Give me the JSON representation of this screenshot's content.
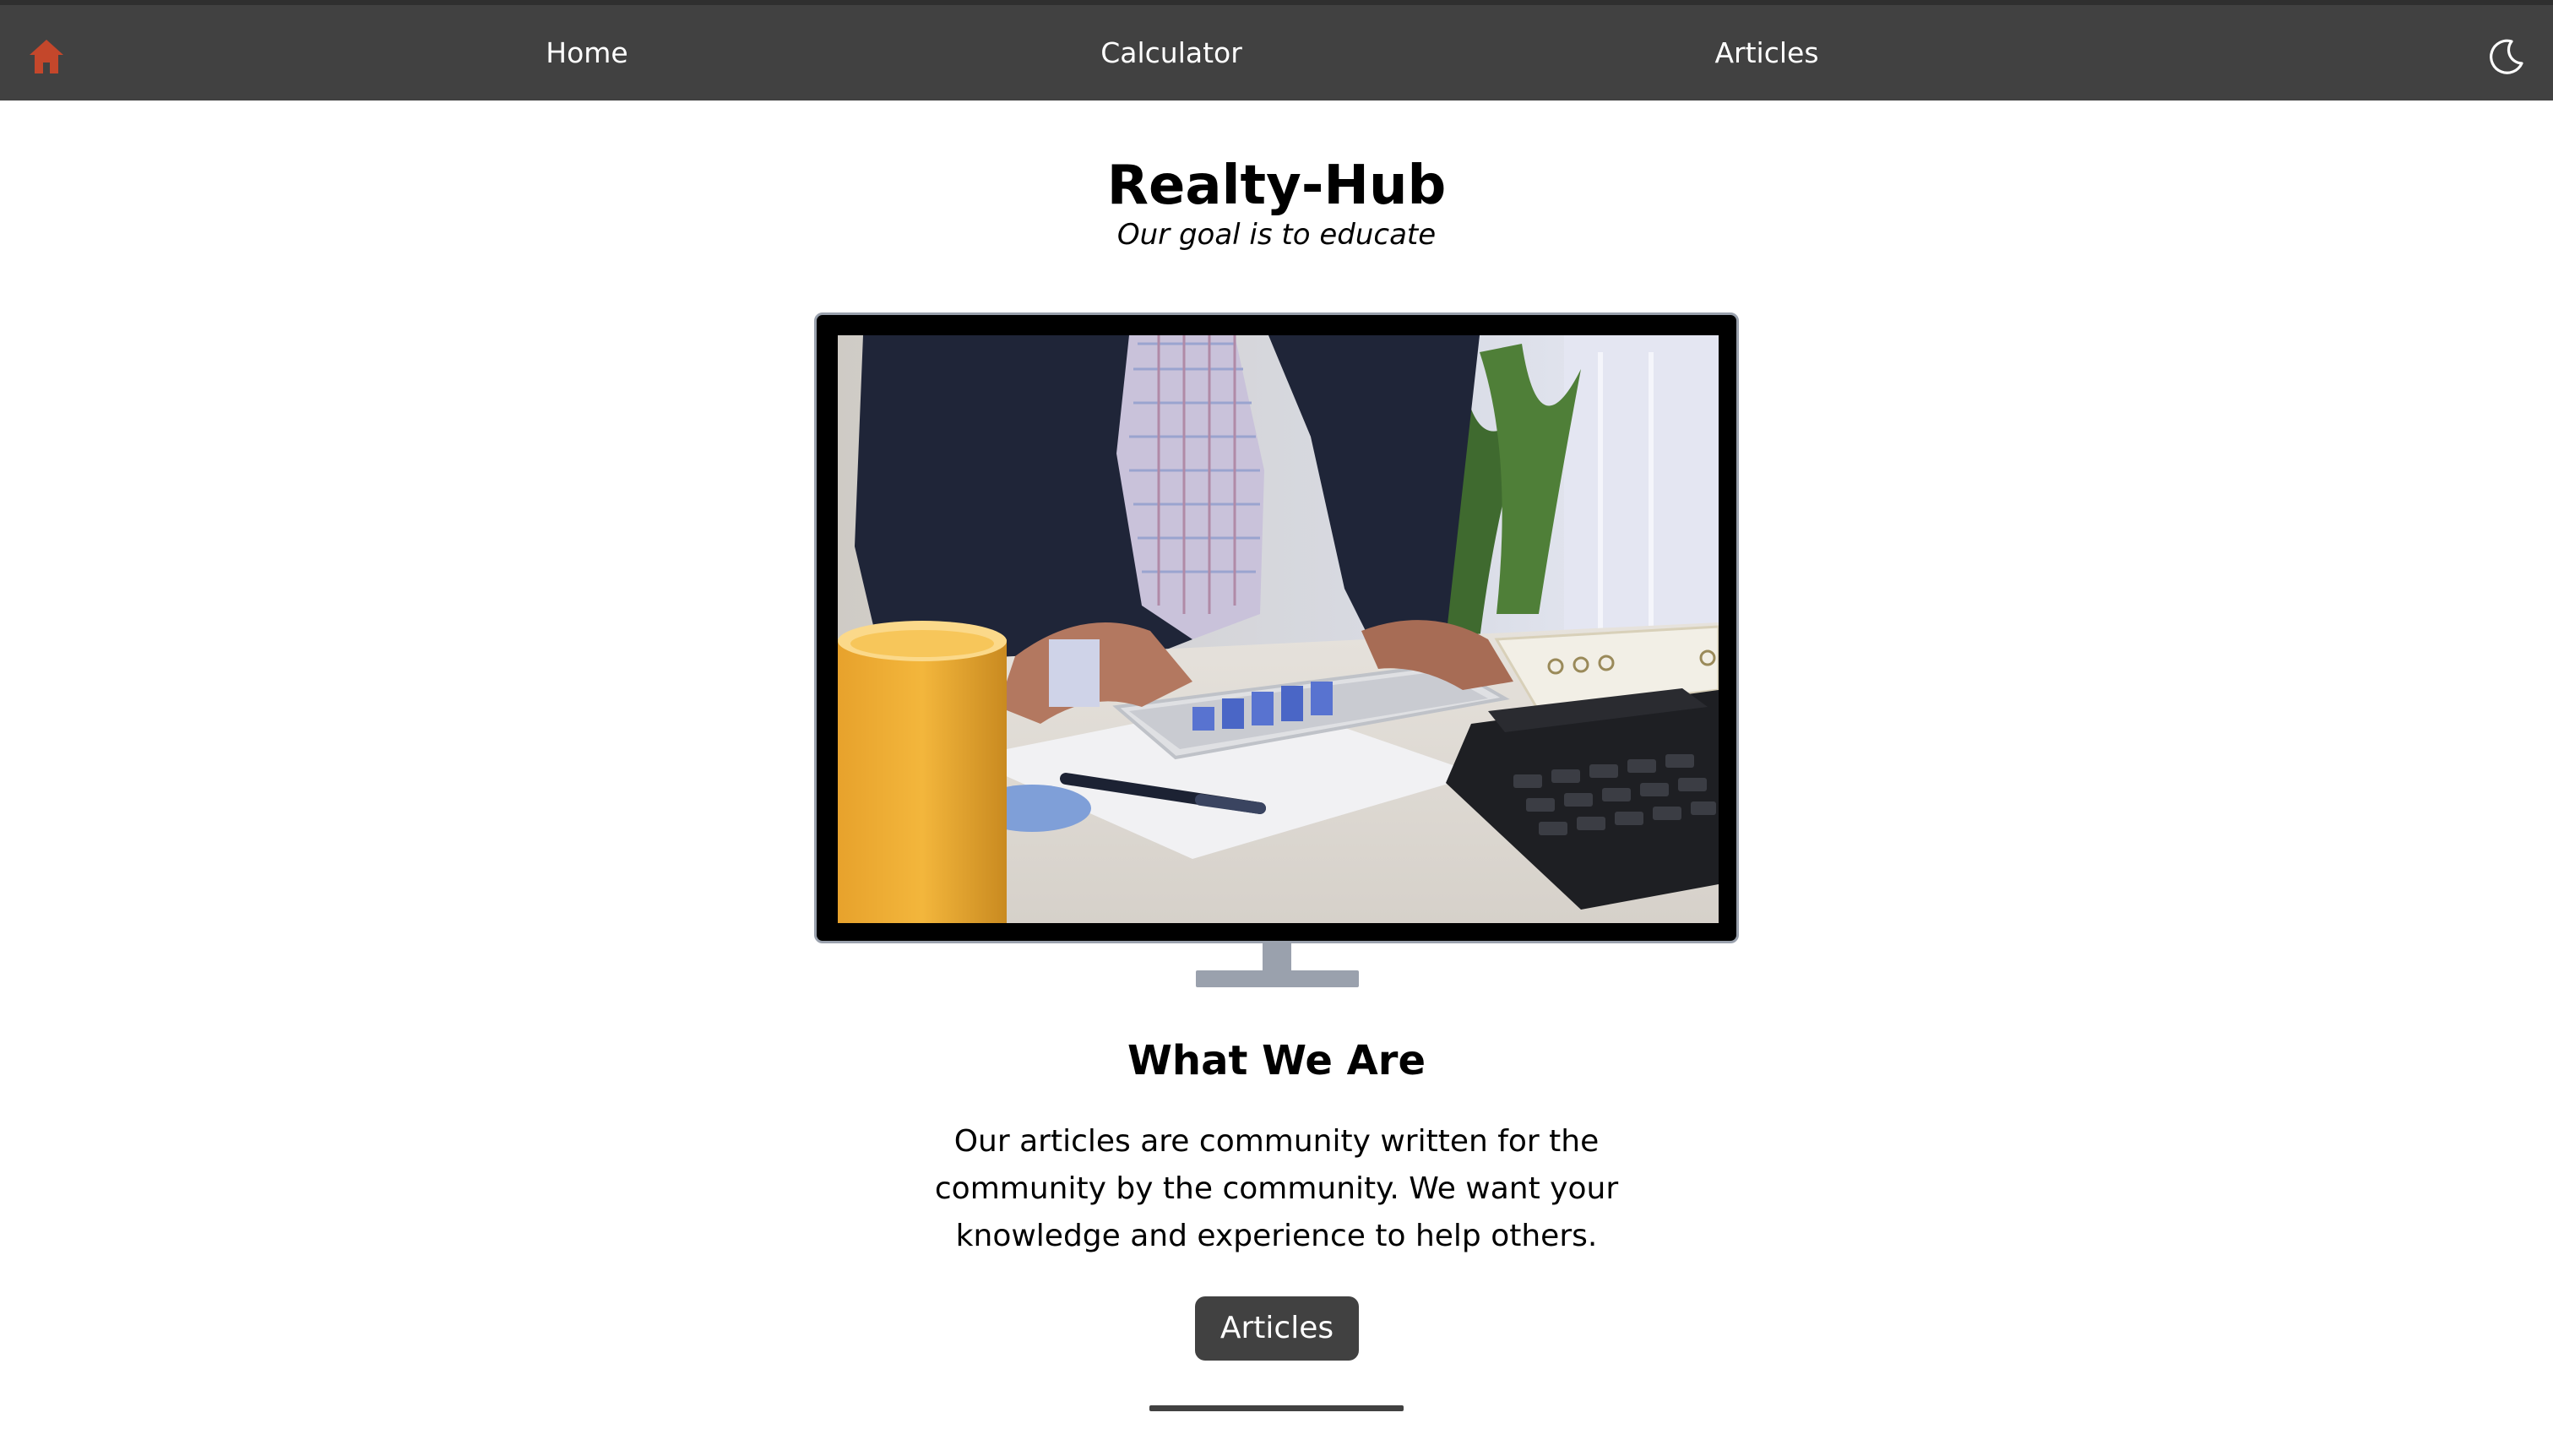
{
  "nav": {
    "home_icon": "house-icon",
    "home_icon_color": "#c4472b",
    "links": [
      {
        "label": "Home"
      },
      {
        "label": "Calculator"
      },
      {
        "label": "Articles"
      }
    ],
    "theme_icon": "moon-icon"
  },
  "hero": {
    "title": "Realty-Hub",
    "tagline": "Our goal is to educate"
  },
  "about": {
    "heading": "What We Are",
    "body": "Our articles are community written for the community by the community. We want your knowledge and experience to help others.",
    "button_label": "Articles"
  },
  "colors": {
    "nav_background": "#414141",
    "button_background": "#414141",
    "monitor_frame": "#9aa1ad"
  }
}
